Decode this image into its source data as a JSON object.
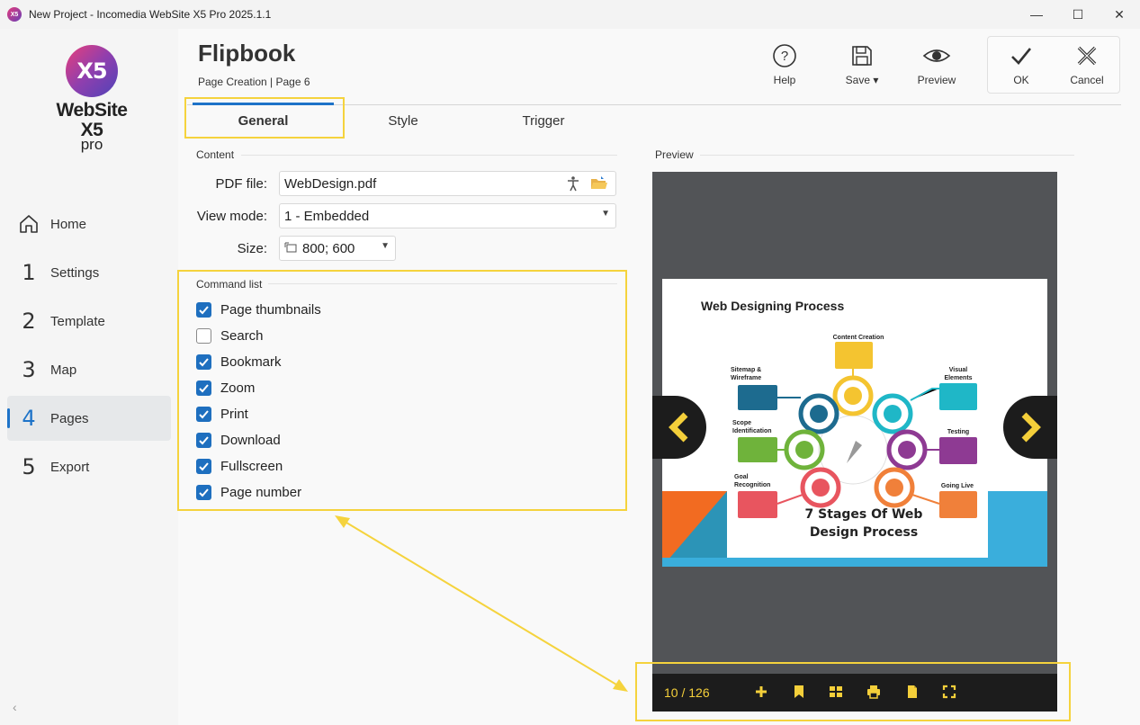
{
  "window": {
    "title": "New Project - Incomedia WebSite X5 Pro 2025.1.1",
    "minimize": "—",
    "maximize": "☐",
    "close": "✕"
  },
  "logo": {
    "mark": "X5",
    "name": "WebSite X5",
    "edition": "pro"
  },
  "sidebar": {
    "items": [
      {
        "num": "",
        "label": "Home",
        "icon": "home-icon"
      },
      {
        "num": "1",
        "label": "Settings"
      },
      {
        "num": "2",
        "label": "Template"
      },
      {
        "num": "3",
        "label": "Map"
      },
      {
        "num": "4",
        "label": "Pages",
        "active": true
      },
      {
        "num": "5",
        "label": "Export"
      }
    ],
    "collapse": "‹"
  },
  "header": {
    "title": "Flipbook",
    "subtitle": "Page Creation | Page 6",
    "help": "Help",
    "save": "Save",
    "preview": "Preview",
    "ok": "OK",
    "cancel": "Cancel"
  },
  "tabs": [
    {
      "label": "General",
      "active": true
    },
    {
      "label": "Style"
    },
    {
      "label": "Trigger"
    }
  ],
  "content": {
    "section_label": "Content",
    "pdf_label": "PDF file:",
    "pdf_value": "WebDesign.pdf",
    "view_label": "View mode:",
    "view_value": "1 - Embedded",
    "size_label": "Size:",
    "size_value": "800; 600"
  },
  "commands": {
    "section_label": "Command list",
    "items": [
      {
        "label": "Page thumbnails",
        "checked": true
      },
      {
        "label": "Search",
        "checked": false
      },
      {
        "label": "Bookmark",
        "checked": true
      },
      {
        "label": "Zoom",
        "checked": true
      },
      {
        "label": "Print",
        "checked": true
      },
      {
        "label": "Download",
        "checked": true
      },
      {
        "label": "Fullscreen",
        "checked": true
      },
      {
        "label": "Page number",
        "checked": true
      }
    ]
  },
  "preview": {
    "label": "Preview",
    "slide_title": "Web Designing Process",
    "slide_heading_1": "7 Stages Of Web",
    "slide_heading_2": "Design Process",
    "stages": {
      "content": "Content Creation",
      "sitemap_1": "Sitemap &",
      "sitemap_2": "Wireframe",
      "visual_1": "Visual",
      "visual_2": "Elements",
      "scope_1": "Scope",
      "scope_2": "Identification",
      "testing": "Testing",
      "goal_1": "Goal",
      "goal_2": "Recognition",
      "live": "Going Live"
    },
    "page_counter": "10 / 126",
    "accent": "#f4cf3a"
  },
  "colors": {
    "highlight": "#f5d33d",
    "accent_blue": "#1e73c8"
  }
}
